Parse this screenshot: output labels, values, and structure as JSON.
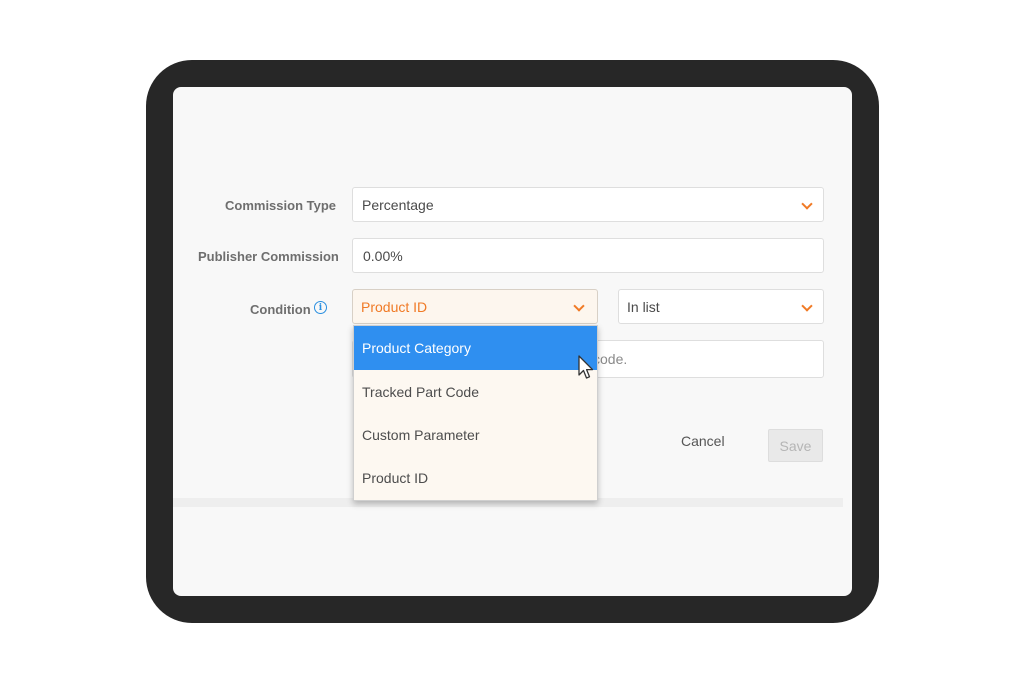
{
  "form": {
    "commission_type": {
      "label": "Commission Type",
      "value": "Percentage"
    },
    "publisher_commission": {
      "label": "Publisher Commission",
      "value": "0.00%"
    },
    "condition": {
      "label": "Condition",
      "field_value": "Product ID",
      "operator_value": "In list",
      "hidden_input_fragment": "code.",
      "options": [
        "Product Category",
        "Tracked Part Code",
        "Custom Parameter",
        "Product ID"
      ],
      "highlighted_option": "Product Category"
    },
    "actions": {
      "cancel_label": "Cancel",
      "save_label": "Save"
    }
  },
  "icons": {
    "info": "info-icon",
    "chevron": "chevron-down-icon",
    "cursor": "mouse-pointer-icon"
  },
  "colors": {
    "accent": "#f07a26",
    "highlight": "#2f8ff0",
    "info": "#2a8fe0",
    "device_frame": "#272727"
  }
}
